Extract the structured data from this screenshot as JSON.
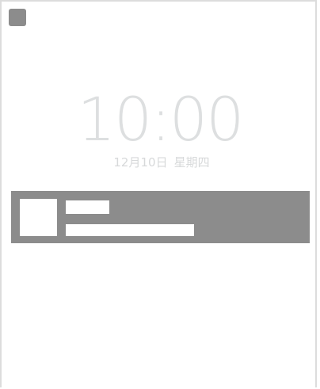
{
  "lockscreen": {
    "time": "10:00",
    "date": "12月10日",
    "weekday": "星期四"
  },
  "colors": {
    "clock_text": "#dddfe0",
    "date_text": "#d7d9da",
    "placeholder_gray": "#8c8c8c",
    "placeholder_white": "#ffffff",
    "frame_border": "#dcdcdc"
  },
  "icons": {
    "corner": "app-icon-placeholder"
  }
}
